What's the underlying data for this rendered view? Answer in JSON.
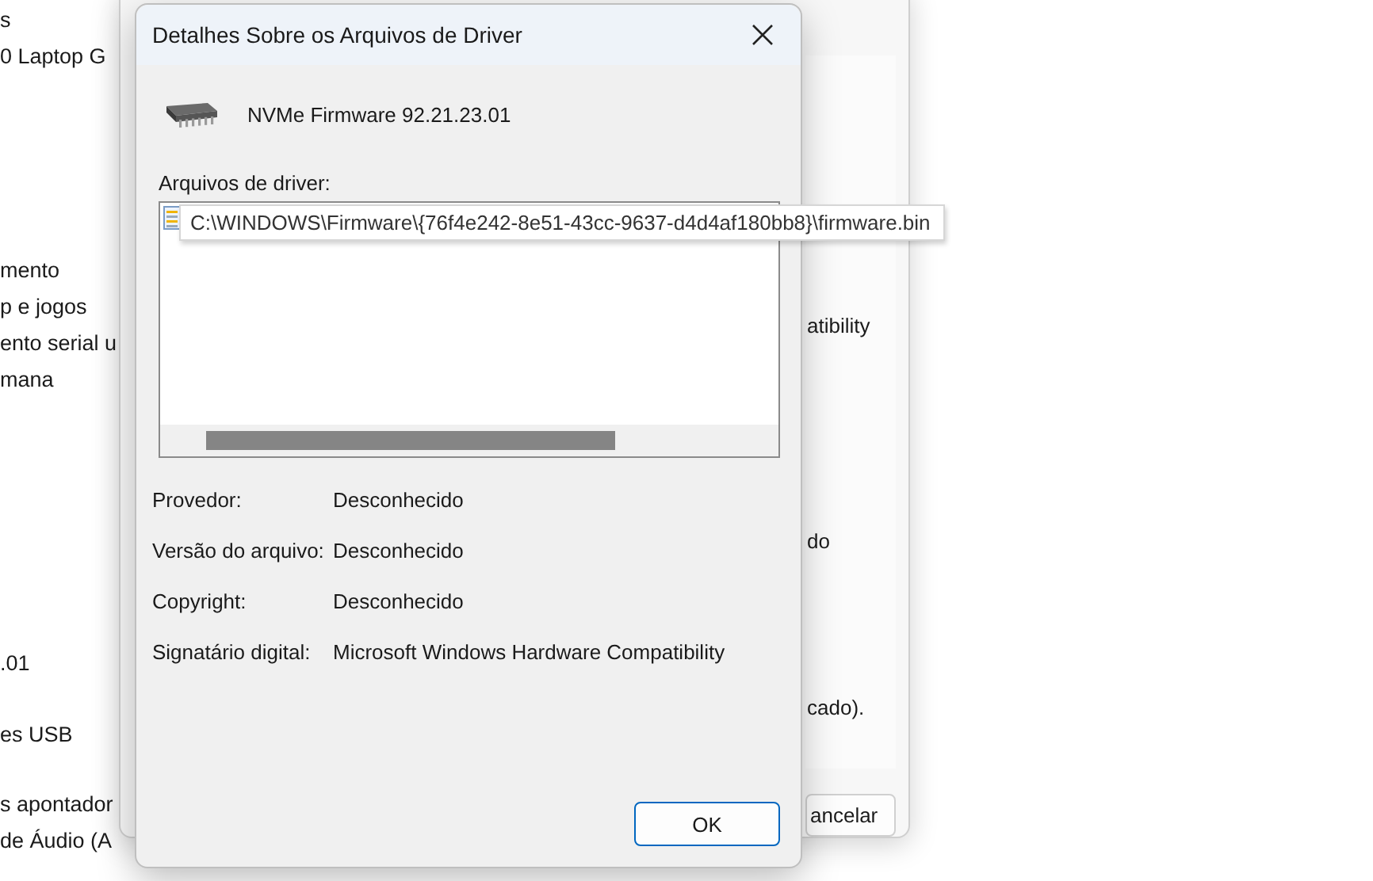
{
  "background_list": {
    "groups": [
      [
        "s",
        "0 Laptop G"
      ],
      [
        "mento",
        "p e jogos",
        "ento serial u",
        "mana"
      ],
      [
        ".01"
      ],
      [
        "es USB"
      ],
      [
        "s apontador",
        "de Áudio (A"
      ]
    ]
  },
  "back_dialog": {
    "texts": [
      "atibility",
      "do",
      "cado)."
    ],
    "buttons": [
      "ancelar"
    ]
  },
  "dialog": {
    "title": "Detalhes Sobre os Arquivos de Driver",
    "device_name": "NVMe Firmware 92.21.23.01",
    "files_label": "Arquivos de driver:",
    "files": [
      {
        "tooltip": "C:\\WINDOWS\\Firmware\\{76f4e242-8e51-43cc-9637-d4d4af180bb8}\\firmware.bin"
      }
    ],
    "properties": [
      {
        "label": "Provedor:",
        "value": "Desconhecido"
      },
      {
        "label": "Versão do arquivo:",
        "value": "Desconhecido"
      },
      {
        "label": "Copyright:",
        "value": "Desconhecido"
      },
      {
        "label": "Signatário digital:",
        "value": "Microsoft Windows Hardware Compatibility"
      }
    ],
    "buttons": [
      "OK"
    ]
  }
}
